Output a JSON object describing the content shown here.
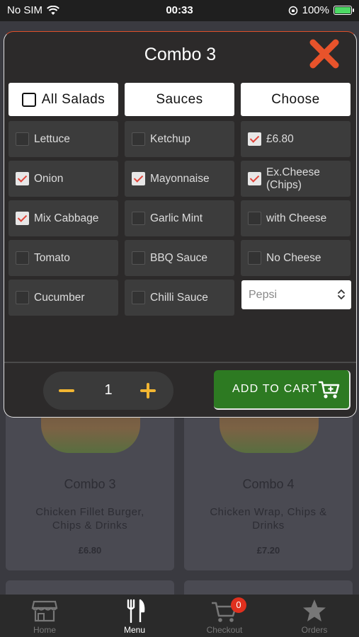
{
  "status_bar": {
    "carrier": "No SIM",
    "time": "00:33",
    "battery_percent": "100%",
    "battery_level": 1.0
  },
  "modal": {
    "title": "Combo 3",
    "columns": [
      {
        "header": "All Salads",
        "has_checkbox": true,
        "options": [
          {
            "label": "Lettuce",
            "checked": false
          },
          {
            "label": "Onion",
            "checked": true
          },
          {
            "label": "Mix Cabbage",
            "checked": true
          },
          {
            "label": "Tomato",
            "checked": false
          },
          {
            "label": "Cucumber",
            "checked": false
          }
        ]
      },
      {
        "header": "Sauces",
        "options": [
          {
            "label": "Ketchup",
            "checked": false
          },
          {
            "label": "Mayonnaise",
            "checked": true
          },
          {
            "label": "Garlic Mint",
            "checked": false
          },
          {
            "label": "BBQ Sauce",
            "checked": false
          },
          {
            "label": "Chilli Sauce",
            "checked": false
          }
        ]
      },
      {
        "header": "Choose",
        "options": [
          {
            "label": "£6.80",
            "checked": true
          },
          {
            "label": "Ex.Cheese (Chips)",
            "checked": true
          },
          {
            "label": "with Cheese",
            "checked": false
          },
          {
            "label": "No Cheese",
            "checked": false
          }
        ]
      }
    ],
    "drink_select": {
      "value": "Pepsi"
    },
    "quantity": "1",
    "add_to_cart_label": "ADD TO CART"
  },
  "menu_items": [
    {
      "name": "Combo 3",
      "description": "Chicken Fillet Burger, Chips & Drinks",
      "price": "£6.80"
    },
    {
      "name": "Combo 4",
      "description": "Chicken Wrap, Chips & Drinks",
      "price": "£7.20"
    }
  ],
  "tabbar": {
    "tabs": [
      {
        "label": "Home",
        "icon": "store-icon"
      },
      {
        "label": "Menu",
        "icon": "fork-knife-icon",
        "active": true
      },
      {
        "label": "Checkout",
        "icon": "cart-icon",
        "badge": "0"
      },
      {
        "label": "Orders",
        "icon": "star-icon"
      }
    ]
  },
  "colors": {
    "accent_close": "#e8532b",
    "checkbox_tick": "#e0443a",
    "qty_control": "#f2b632",
    "add_to_cart_bg": "#2d7a22",
    "badge": "#e0301e"
  }
}
